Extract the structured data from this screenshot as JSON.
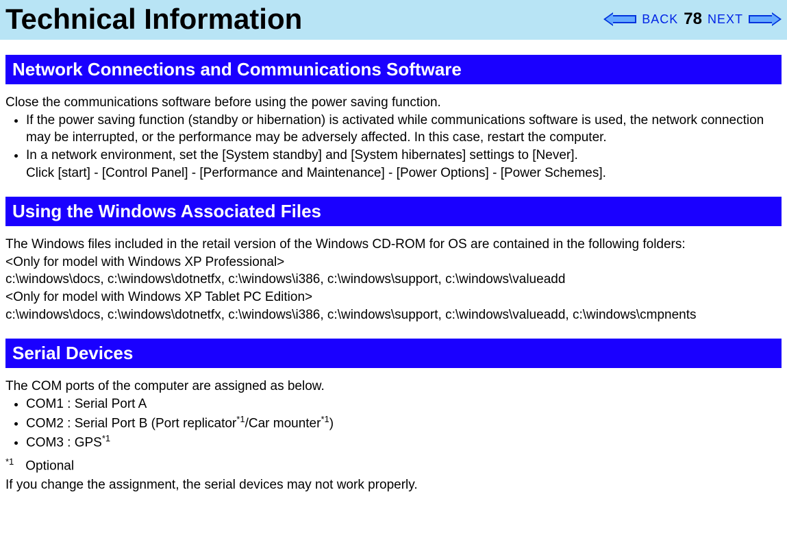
{
  "header": {
    "title": "Technical Information",
    "back_label": "BACK",
    "page_number": "78",
    "next_label": "NEXT"
  },
  "section1": {
    "heading": "Network Connections and Communications Software",
    "intro": "Close the communications software before using the power saving function.",
    "bullet1": "If the power saving function (standby or hibernation) is activated while communications software is used, the network connection may be interrupted, or the performance may be adversely affected. In this case, restart the computer.",
    "bullet2_line1": "In a network environment, set the [System standby] and [System hibernates] settings to [Never].",
    "bullet2_line2": "Click [start] - [Control Panel] - [Performance and Maintenance] - [Power Options] - [Power Schemes]."
  },
  "section2": {
    "heading": "Using the Windows Associated Files",
    "line1": "The Windows files included in the retail version of the Windows CD-ROM for OS are contained in the following folders:",
    "line2": "<Only for model with Windows XP Professional>",
    "line3": "c:\\windows\\docs, c:\\windows\\dotnetfx, c:\\windows\\i386, c:\\windows\\support, c:\\windows\\valueadd",
    "line4": "<Only for model with Windows XP Tablet PC Edition>",
    "line5": "c:\\windows\\docs, c:\\windows\\dotnetfx, c:\\windows\\i386, c:\\windows\\support, c:\\windows\\valueadd, c:\\windows\\cmpnents"
  },
  "section3": {
    "heading": "Serial Devices",
    "intro": "The COM ports of the computer are assigned as below.",
    "bullet1": "COM1 : Serial Port A",
    "bullet2_pre": "COM2 : Serial Port B (Port replicator",
    "bullet2_mid": "/Car mounter",
    "bullet2_post": ")",
    "bullet3_pre": "COM3 : GPS",
    "footnote_marker": "*1",
    "footnote_text": "Optional",
    "closing": "If you change the assignment, the serial devices may not work properly."
  }
}
